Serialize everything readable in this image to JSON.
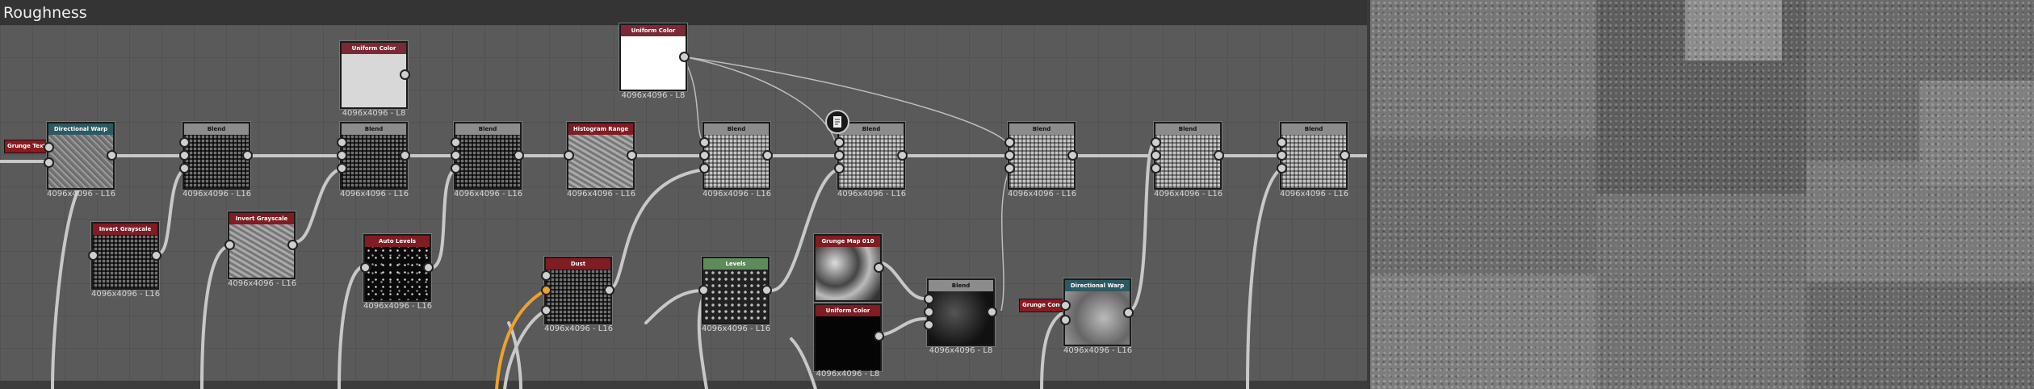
{
  "header": {
    "title": "Roughness"
  },
  "tags": {
    "tag1": "Grunge Text...",
    "tag2": "Grunge Conc..."
  },
  "nodes": {
    "n1": {
      "title": "Directional Warp",
      "res": "4096x4096 - L16"
    },
    "n2": {
      "title": "Blend",
      "res": "4096x4096 - L16"
    },
    "n3": {
      "title": "Uniform Color",
      "res": "4096x4096 - L8"
    },
    "n4": {
      "title": "Blend",
      "res": "4096x4096 - L16"
    },
    "n5": {
      "title": "Blend",
      "res": "4096x4096 - L16"
    },
    "n6": {
      "title": "Histogram Range",
      "res": "4096x4096 - L16"
    },
    "n7": {
      "title": "Uniform Color",
      "res": "4096x4096 - L8"
    },
    "n8": {
      "title": "Blend",
      "res": "4096x4096 - L16"
    },
    "n9": {
      "title": "Blend",
      "res": "4096x4096 - L16"
    },
    "n10": {
      "title": "Blend",
      "res": "4096x4096 - L16"
    },
    "n11": {
      "title": "Blend",
      "res": "4096x4096 - L16"
    },
    "n12": {
      "title": "Blend",
      "res": "4096x4096 - L16"
    },
    "n13": {
      "title": "Invert Grayscale",
      "res": "4096x4096 - L16"
    },
    "n14": {
      "title": "Invert Grayscale",
      "res": "4096x4096 - L16"
    },
    "n15": {
      "title": "Auto Levels",
      "res": "4096x4096 - L16"
    },
    "n16": {
      "title": "Dust",
      "res": "4096x4096 - L16"
    },
    "n17": {
      "title": "Levels",
      "res": "4096x4096 - L16"
    },
    "n18": {
      "title": "Grunge Map 010",
      "res": ""
    },
    "n19": {
      "title": "Uniform Color",
      "res": "4096x4096 - L8"
    },
    "n20": {
      "title": "Blend",
      "res": "4096x4096 - L8"
    },
    "n21": {
      "title": "Directional Warp",
      "res": "4096x4096 - L16"
    }
  },
  "icons": {
    "comment": "document-icon"
  },
  "colors": {
    "graph_bg": "#5a5a5a",
    "header_red": "#7f1c24",
    "header_teal": "#2d5a62",
    "header_green": "#5f8a5c",
    "wire_orange": "#f0a030"
  }
}
